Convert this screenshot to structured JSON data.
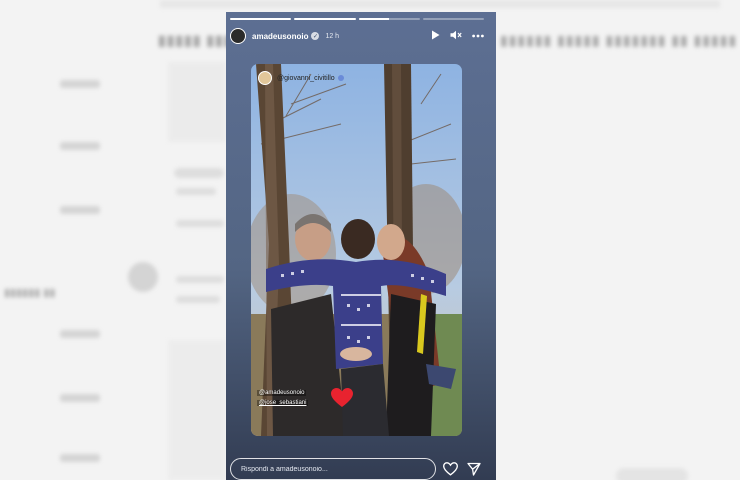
{
  "story": {
    "username": "amadeusonoio",
    "time": "12 h",
    "progress": [
      1,
      1,
      0.5,
      0
    ],
    "controls": {
      "play_icon": "play-icon",
      "mute_icon": "speaker-muted-icon",
      "more_icon": "more-icon"
    },
    "repost": {
      "source_user": "@giovanni_civitillo",
      "mentions": [
        "@amadeusonoio",
        "@jose_sebastiani"
      ]
    },
    "reply": {
      "placeholder": "Rispondi a amadeusonoio...",
      "like_icon": "heart-icon",
      "send_icon": "send-icon"
    }
  },
  "colors": {
    "heart_sticker": "#e8232f",
    "story_bg": "#5d6f93"
  }
}
